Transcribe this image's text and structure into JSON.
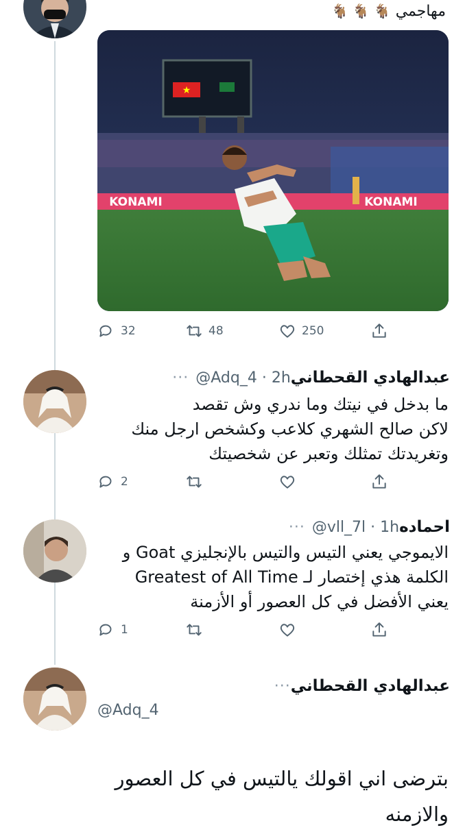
{
  "top_tweet": {
    "text": "مهاجمي",
    "emoji": [
      "🐐",
      "🐐",
      "🐐"
    ],
    "media": {
      "banner_left": "KONAMI",
      "banner_right": "KONAMI"
    },
    "replies": "32",
    "retweets": "48",
    "likes": "250"
  },
  "reply1": {
    "name": "عبدالهادي القحطاني",
    "handle": "@Adq_4 · 2h",
    "more": "···",
    "lines": [
      "ما بدخل في نيتك وما ندري وش تقصد",
      "لاكن صالح الشهري كلاعب وكشخص ارجل منك",
      "وتغريدتك تمثلك وتعبر عن شخصيتك"
    ],
    "replies": "2",
    "retweets": "",
    "likes": ""
  },
  "reply2": {
    "name": "احماده",
    "handle": "@vll_7l · 1h",
    "more": "···",
    "lines": [
      "الايموجي يعني التيس والتيس بالإنجليزي Goat و",
      "الكلمة هذي إختصار لـ Greatest of All Time",
      "يعني الأفضل في كل العصور أو الأزمنة"
    ],
    "replies": "1",
    "retweets": "",
    "likes": ""
  },
  "main_tweet": {
    "name": "عبدالهادي القحطاني",
    "handle": "@Adq_4",
    "more": "···",
    "lines": [
      "بترضى اني اقولك يالتيس في كل العصور",
      "والازمنه"
    ]
  },
  "colors": {
    "text": "#0f1419",
    "muted": "#536471",
    "thread": "#cfd9de"
  }
}
